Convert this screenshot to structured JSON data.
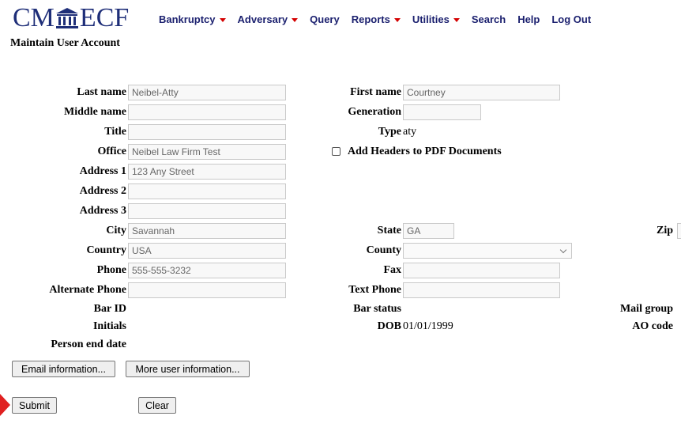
{
  "app": {
    "logo_left": "CM",
    "logo_right": "ECF"
  },
  "nav": [
    {
      "label": "Bankruptcy",
      "dropdown": true
    },
    {
      "label": "Adversary",
      "dropdown": true
    },
    {
      "label": "Query",
      "dropdown": false
    },
    {
      "label": "Reports",
      "dropdown": true
    },
    {
      "label": "Utilities",
      "dropdown": true
    },
    {
      "label": "Search",
      "dropdown": false
    },
    {
      "label": "Help",
      "dropdown": false
    },
    {
      "label": "Log Out",
      "dropdown": false
    }
  ],
  "page_title": "Maintain User Account",
  "form": {
    "last_name": {
      "label": "Last name",
      "value": "Neibel-Atty"
    },
    "first_name": {
      "label": "First name",
      "value": "Courtney"
    },
    "middle_name": {
      "label": "Middle name",
      "value": ""
    },
    "generation": {
      "label": "Generation",
      "value": ""
    },
    "title": {
      "label": "Title",
      "value": ""
    },
    "type": {
      "label": "Type",
      "value": "aty"
    },
    "office": {
      "label": "Office",
      "value": "Neibel Law Firm Test"
    },
    "add_headers": {
      "label": "Add Headers to PDF Documents",
      "checked": false
    },
    "address1": {
      "label": "Address 1",
      "value": "123 Any Street"
    },
    "address2": {
      "label": "Address 2",
      "value": ""
    },
    "address3": {
      "label": "Address 3",
      "value": ""
    },
    "city": {
      "label": "City",
      "value": "Savannah"
    },
    "state": {
      "label": "State",
      "value": "GA"
    },
    "zip": {
      "label": "Zip",
      "value": ""
    },
    "country": {
      "label": "Country",
      "value": "USA"
    },
    "county": {
      "label": "County",
      "value": ""
    },
    "phone": {
      "label": "Phone",
      "value": "555-555-3232"
    },
    "fax": {
      "label": "Fax",
      "value": ""
    },
    "alternate_phone": {
      "label": "Alternate Phone",
      "value": ""
    },
    "text_phone": {
      "label": "Text Phone",
      "value": ""
    },
    "bar_id": {
      "label": "Bar ID",
      "value": ""
    },
    "bar_status": {
      "label": "Bar status",
      "value": ""
    },
    "mail_group": {
      "label": "Mail group",
      "value": ""
    },
    "initials": {
      "label": "Initials",
      "value": ""
    },
    "dob": {
      "label": "DOB",
      "value": "01/01/1999"
    },
    "ao_code": {
      "label": "AO code",
      "value": ""
    },
    "person_end_date": {
      "label": "Person end date",
      "value": ""
    }
  },
  "buttons": {
    "email_info": "Email information...",
    "more_info": "More user information...",
    "submit": "Submit",
    "clear": "Clear"
  },
  "colors": {
    "logo": "#1e2e78",
    "nav_text": "#1a1f6e",
    "caret": "#d40000",
    "arrow_marker": "#e02020"
  }
}
